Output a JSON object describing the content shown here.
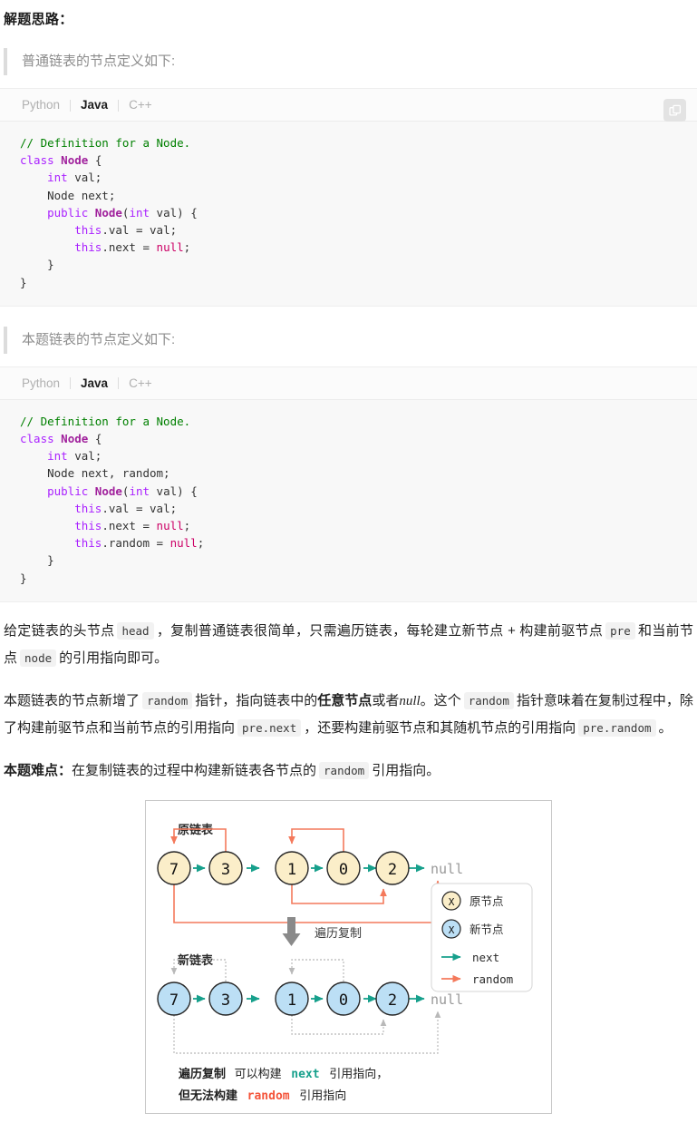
{
  "heading": "解题思路：",
  "quote1": "普通链表的节点定义如下:",
  "quote2": "本题链表的节点定义如下:",
  "code_block_1": {
    "tabs": [
      "Python",
      "Java",
      "C++"
    ],
    "active_tab": "Java",
    "copy_icon": "copy-icon",
    "lines": [
      "// Definition for a Node.",
      "class Node {",
      "    int val;",
      "    Node next;",
      "    public Node(int val) {",
      "        this.val = val;",
      "        this.next = null;",
      "    }",
      "}"
    ]
  },
  "code_block_2": {
    "tabs": [
      "Python",
      "Java",
      "C++"
    ],
    "active_tab": "Java",
    "lines": [
      "// Definition for a Node.",
      "class Node {",
      "    int val;",
      "    Node next, random;",
      "    public Node(int val) {",
      "        this.val = val;",
      "        this.next = null;",
      "        this.random = null;",
      "    }",
      "}"
    ]
  },
  "paragraphs": {
    "p1": {
      "s1": "给定链表的头节点",
      "c1": "head",
      "s2": "，复制普通链表很简单，只需遍历链表，每轮建立新节点 + 构建前驱节点",
      "c2": "pre",
      "s3": "和当前节点",
      "c3": "node",
      "s4": "的引用指向即可。"
    },
    "p2": {
      "s1": "本题链表的节点新增了",
      "c1": "random",
      "s2": "指针，指向链表中的",
      "b1": "任意节点",
      "s3": "或者",
      "i1": "null",
      "s4": "。这个",
      "c2": "random",
      "s5": "指针意味着在复制过程中，除了构建前驱节点和当前节点的引用指向",
      "c3": "pre.next",
      "s6": "，还要构建前驱节点和其随机节点的引用指向",
      "c4": "pre.random",
      "s7": "。"
    },
    "p3": {
      "b1": "本题难点：",
      "s1": "在复制链表的过程中构建新链表各节点的",
      "c1": "random",
      "s2": "引用指向。"
    }
  },
  "figure": {
    "label_original": "原链表",
    "label_new": "新链表",
    "label_transform": "遍历复制",
    "null_label": "null",
    "nodes": [
      7,
      3,
      1,
      0,
      2
    ],
    "random_edges_original": [
      {
        "from": 3,
        "to": 7,
        "side": "top"
      },
      {
        "from": 0,
        "to": 1,
        "side": "top"
      },
      {
        "from": 1,
        "to": 2,
        "side": "bottom"
      },
      {
        "from": 7,
        "to": "null",
        "side": "bottom"
      }
    ],
    "legend": {
      "items": [
        {
          "glyph": "X",
          "label": "原节点",
          "type": "node-original"
        },
        {
          "glyph": "X",
          "label": "新节点",
          "type": "node-new"
        },
        {
          "glyph": "→",
          "label": "next",
          "type": "arrow-next"
        },
        {
          "glyph": "→",
          "label": "random",
          "type": "arrow-random"
        }
      ]
    },
    "caption": {
      "line1_a": "遍历复制",
      "line1_b": "可以构建",
      "line1_code": "next",
      "line1_c": "引用指向，",
      "line2_a": "但无法构建",
      "line2_code": "random",
      "line2_b": "引用指向"
    },
    "colors": {
      "node_original_fill": "#fbeec9",
      "node_new_fill": "#bcdff5",
      "node_stroke": "#262626",
      "next_arrow": "#17a08c",
      "random_arrow": "#f4795b",
      "random_arrow_gray": "#c9c9c9",
      "null_text": "#999999",
      "transform_arrow": "#8a8a8a",
      "caption_next": "#17a08c",
      "caption_random": "#f4543a"
    }
  }
}
